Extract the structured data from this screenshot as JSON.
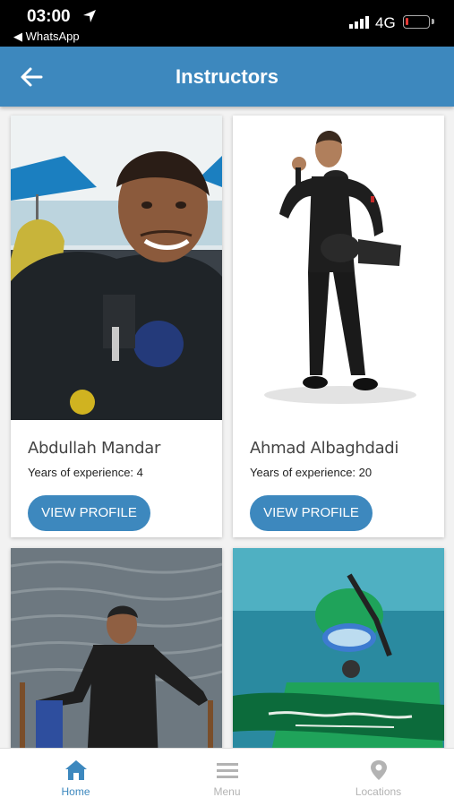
{
  "status_bar": {
    "time": "03:00",
    "back_app": "◀ WhatsApp",
    "network": "4G",
    "battery_level": 0.15
  },
  "header": {
    "title": "Instructors",
    "back_icon": "arrow-left-icon"
  },
  "instructors": [
    {
      "name": "Abdullah Mandar",
      "experience": "Years of experience: 4",
      "button": "VIEW PROFILE"
    },
    {
      "name": "Ahmad Albaghdadi",
      "experience": "Years of experience: 20",
      "button": "VIEW PROFILE"
    },
    {
      "name": "",
      "experience": "",
      "button": ""
    },
    {
      "name": "",
      "experience": "",
      "button": ""
    }
  ],
  "tabs": [
    {
      "label": "Home",
      "icon": "home-icon",
      "active": true
    },
    {
      "label": "Menu",
      "icon": "menu-icon",
      "active": false
    },
    {
      "label": "Locations",
      "icon": "location-pin-icon",
      "active": false
    }
  ],
  "colors": {
    "primary": "#3d88be",
    "tab_active": "#3d88be",
    "tab_inactive": "#b3b3b3"
  }
}
